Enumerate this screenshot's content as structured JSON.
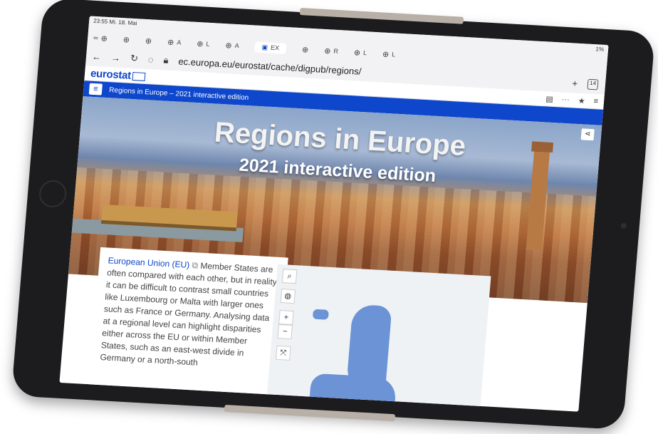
{
  "status_bar": {
    "time_date": "23:55 Mi. 18. Mai",
    "battery": "1%"
  },
  "tabs": [
    {
      "label": "A",
      "active": false
    },
    {
      "label": "L",
      "active": false
    },
    {
      "label": "A",
      "active": false
    },
    {
      "label": "EX",
      "active": true
    },
    {
      "label": "R",
      "active": false
    },
    {
      "label": "L",
      "active": false
    },
    {
      "label": "L",
      "active": false
    }
  ],
  "browser": {
    "url": "ec.europa.eu/eurostat/cache/digpub/regions/",
    "tab_count": "14"
  },
  "site": {
    "logo": "eurostat",
    "page_title": "Regions in Europe – 2021 interactive edition"
  },
  "hero": {
    "title": "Regions in Europe",
    "subtitle": "2021 interactive edition"
  },
  "content": {
    "link_text": "European Union (EU)",
    "body": "Member States are often compared with each other, but in reality it can be difficult to contrast small countries like Luxembourg or Malta with larger ones such as France or Germany. Analysing data at a regional level can highlight disparities either across the EU or within Member States, such as an east-west divide in Germany or a north-south"
  },
  "map_controls": {
    "zoom_in": "+",
    "zoom_out": "−"
  },
  "colors": {
    "brand_blue": "#0e47cb",
    "map_land": "#6b93d6"
  }
}
